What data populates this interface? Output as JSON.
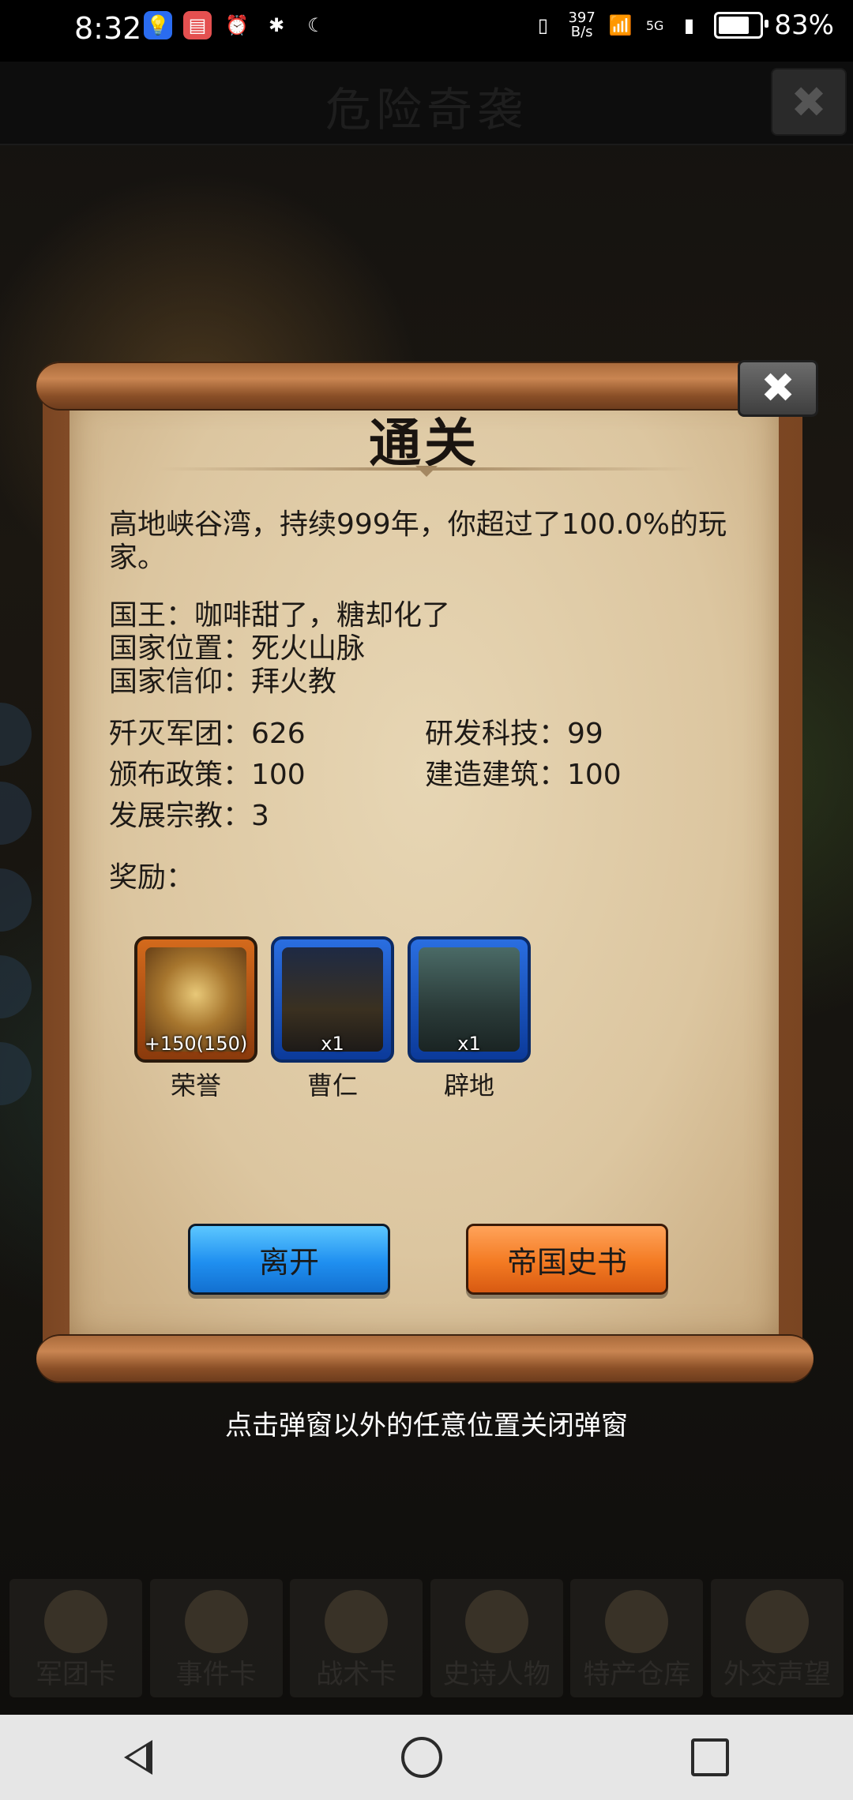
{
  "status_bar": {
    "time": "8:32",
    "net_speed_value": "397",
    "net_speed_unit": "B/s",
    "network": "5G",
    "battery": "83%"
  },
  "game": {
    "title": "危险奇袭",
    "close_symbol": "✖",
    "tabs": [
      "军团卡",
      "事件卡",
      "战术卡",
      "史诗人物",
      "特产仓库",
      "外交声望"
    ]
  },
  "dialog": {
    "title": "通关",
    "close_symbol": "✖",
    "summary": "高地峡谷湾，持续999年，你超过了100.0%的玩家。",
    "king": "国王：咖啡甜了，糖却化了",
    "location": "国家位置：死火山脉",
    "religion": "国家信仰：拜火教",
    "stats": {
      "legions_destroyed": "歼灭军团：626",
      "tech_researched": "研发科技：99",
      "policies_issued": "颁布政策：100",
      "buildings_built": "建造建筑：100",
      "religions_developed": "发展宗教：3"
    },
    "rewards_label": "奖励：",
    "rewards": [
      {
        "name": "荣誉",
        "qty": "+150(150)"
      },
      {
        "name": "曹仁",
        "qty": "x1"
      },
      {
        "name": "辟地",
        "qty": "x1"
      }
    ],
    "leave_button": "离开",
    "history_button": "帝国史书"
  },
  "hint": "点击弹窗以外的任意位置关闭弹窗",
  "colors": {
    "leave_button": "#1f8ff0",
    "history_button": "#f37a22",
    "paper": "#dcc6a0"
  }
}
